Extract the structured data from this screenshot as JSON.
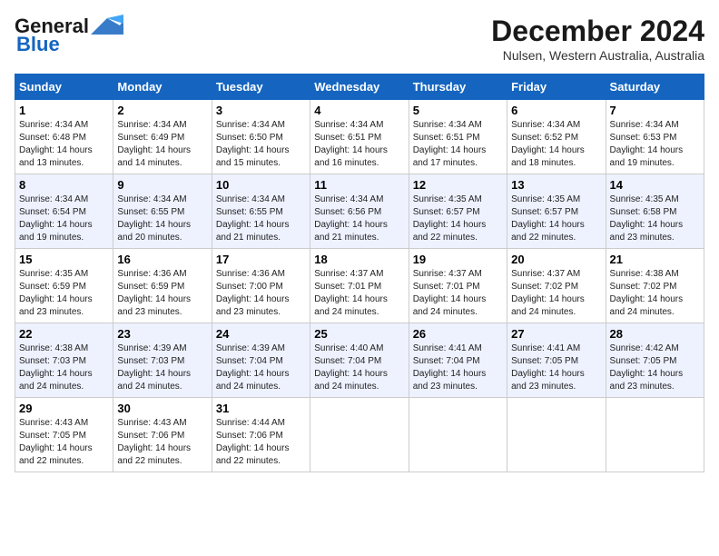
{
  "logo": {
    "line1": "General",
    "line2": "Blue"
  },
  "title": "December 2024",
  "subtitle": "Nulsen, Western Australia, Australia",
  "weekdays": [
    "Sunday",
    "Monday",
    "Tuesday",
    "Wednesday",
    "Thursday",
    "Friday",
    "Saturday"
  ],
  "weeks": [
    [
      {
        "day": 1,
        "sunrise": "4:34 AM",
        "sunset": "6:48 PM",
        "daylight": "14 hours and 13 minutes."
      },
      {
        "day": 2,
        "sunrise": "4:34 AM",
        "sunset": "6:49 PM",
        "daylight": "14 hours and 14 minutes."
      },
      {
        "day": 3,
        "sunrise": "4:34 AM",
        "sunset": "6:50 PM",
        "daylight": "14 hours and 15 minutes."
      },
      {
        "day": 4,
        "sunrise": "4:34 AM",
        "sunset": "6:51 PM",
        "daylight": "14 hours and 16 minutes."
      },
      {
        "day": 5,
        "sunrise": "4:34 AM",
        "sunset": "6:51 PM",
        "daylight": "14 hours and 17 minutes."
      },
      {
        "day": 6,
        "sunrise": "4:34 AM",
        "sunset": "6:52 PM",
        "daylight": "14 hours and 18 minutes."
      },
      {
        "day": 7,
        "sunrise": "4:34 AM",
        "sunset": "6:53 PM",
        "daylight": "14 hours and 19 minutes."
      }
    ],
    [
      {
        "day": 8,
        "sunrise": "4:34 AM",
        "sunset": "6:54 PM",
        "daylight": "14 hours and 19 minutes."
      },
      {
        "day": 9,
        "sunrise": "4:34 AM",
        "sunset": "6:55 PM",
        "daylight": "14 hours and 20 minutes."
      },
      {
        "day": 10,
        "sunrise": "4:34 AM",
        "sunset": "6:55 PM",
        "daylight": "14 hours and 21 minutes."
      },
      {
        "day": 11,
        "sunrise": "4:34 AM",
        "sunset": "6:56 PM",
        "daylight": "14 hours and 21 minutes."
      },
      {
        "day": 12,
        "sunrise": "4:35 AM",
        "sunset": "6:57 PM",
        "daylight": "14 hours and 22 minutes."
      },
      {
        "day": 13,
        "sunrise": "4:35 AM",
        "sunset": "6:57 PM",
        "daylight": "14 hours and 22 minutes."
      },
      {
        "day": 14,
        "sunrise": "4:35 AM",
        "sunset": "6:58 PM",
        "daylight": "14 hours and 23 minutes."
      }
    ],
    [
      {
        "day": 15,
        "sunrise": "4:35 AM",
        "sunset": "6:59 PM",
        "daylight": "14 hours and 23 minutes."
      },
      {
        "day": 16,
        "sunrise": "4:36 AM",
        "sunset": "6:59 PM",
        "daylight": "14 hours and 23 minutes."
      },
      {
        "day": 17,
        "sunrise": "4:36 AM",
        "sunset": "7:00 PM",
        "daylight": "14 hours and 23 minutes."
      },
      {
        "day": 18,
        "sunrise": "4:37 AM",
        "sunset": "7:01 PM",
        "daylight": "14 hours and 24 minutes."
      },
      {
        "day": 19,
        "sunrise": "4:37 AM",
        "sunset": "7:01 PM",
        "daylight": "14 hours and 24 minutes."
      },
      {
        "day": 20,
        "sunrise": "4:37 AM",
        "sunset": "7:02 PM",
        "daylight": "14 hours and 24 minutes."
      },
      {
        "day": 21,
        "sunrise": "4:38 AM",
        "sunset": "7:02 PM",
        "daylight": "14 hours and 24 minutes."
      }
    ],
    [
      {
        "day": 22,
        "sunrise": "4:38 AM",
        "sunset": "7:03 PM",
        "daylight": "14 hours and 24 minutes."
      },
      {
        "day": 23,
        "sunrise": "4:39 AM",
        "sunset": "7:03 PM",
        "daylight": "14 hours and 24 minutes."
      },
      {
        "day": 24,
        "sunrise": "4:39 AM",
        "sunset": "7:04 PM",
        "daylight": "14 hours and 24 minutes."
      },
      {
        "day": 25,
        "sunrise": "4:40 AM",
        "sunset": "7:04 PM",
        "daylight": "14 hours and 24 minutes."
      },
      {
        "day": 26,
        "sunrise": "4:41 AM",
        "sunset": "7:04 PM",
        "daylight": "14 hours and 23 minutes."
      },
      {
        "day": 27,
        "sunrise": "4:41 AM",
        "sunset": "7:05 PM",
        "daylight": "14 hours and 23 minutes."
      },
      {
        "day": 28,
        "sunrise": "4:42 AM",
        "sunset": "7:05 PM",
        "daylight": "14 hours and 23 minutes."
      }
    ],
    [
      {
        "day": 29,
        "sunrise": "4:43 AM",
        "sunset": "7:05 PM",
        "daylight": "14 hours and 22 minutes."
      },
      {
        "day": 30,
        "sunrise": "4:43 AM",
        "sunset": "7:06 PM",
        "daylight": "14 hours and 22 minutes."
      },
      {
        "day": 31,
        "sunrise": "4:44 AM",
        "sunset": "7:06 PM",
        "daylight": "14 hours and 22 minutes."
      },
      null,
      null,
      null,
      null
    ]
  ]
}
